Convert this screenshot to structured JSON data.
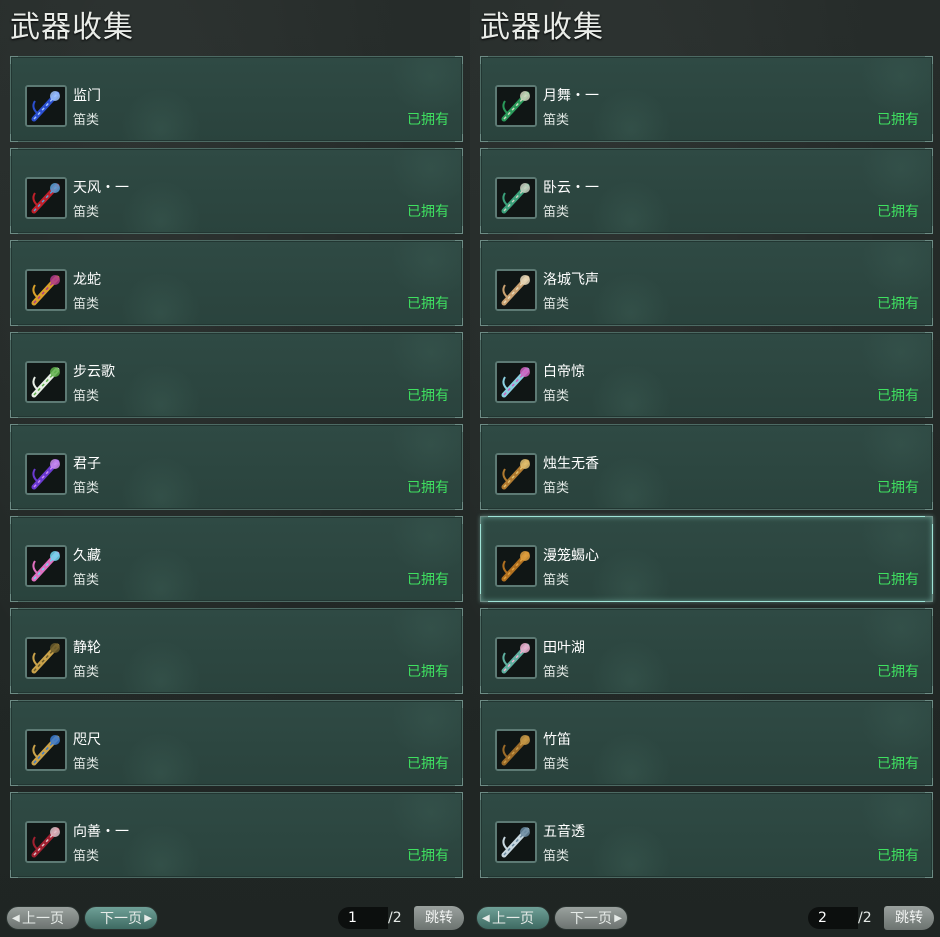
{
  "left": {
    "title": "武器收集",
    "items": [
      {
        "name": "监门",
        "type": "笛类",
        "status": "已拥有",
        "icon": "blue-flute-icon"
      },
      {
        "name": "天风・一",
        "type": "笛类",
        "status": "已拥有",
        "icon": "red-feather-flute-icon"
      },
      {
        "name": "龙蛇",
        "type": "笛类",
        "status": "已拥有",
        "icon": "golden-flute-icon"
      },
      {
        "name": "步云歌",
        "type": "笛类",
        "status": "已拥有",
        "icon": "white-leaf-flute-icon"
      },
      {
        "name": "君子",
        "type": "笛类",
        "status": "已拥有",
        "icon": "purple-flute-icon"
      },
      {
        "name": "久藏",
        "type": "笛类",
        "status": "已拥有",
        "icon": "crystal-flower-flute-icon"
      },
      {
        "name": "静轮",
        "type": "笛类",
        "status": "已拥有",
        "icon": "gold-fan-flute-icon"
      },
      {
        "name": "咫尺",
        "type": "笛类",
        "status": "已拥有",
        "icon": "gold-blue-flute-icon"
      },
      {
        "name": "向善・一",
        "type": "笛类",
        "status": "已拥有",
        "icon": "red-spiked-flute-icon"
      }
    ],
    "pager": {
      "prev": "上一页",
      "next": "下一页",
      "page": "1",
      "total": "/2",
      "jump": "跳转"
    }
  },
  "right": {
    "title": "武器收集",
    "items": [
      {
        "name": "月舞・一",
        "type": "笛类",
        "status": "已拥有",
        "icon": "green-dragon-flute-icon"
      },
      {
        "name": "卧云・一",
        "type": "笛类",
        "status": "已拥有",
        "icon": "jade-dragon-flute-icon"
      },
      {
        "name": "洛城飞声",
        "type": "笛类",
        "status": "已拥有",
        "icon": "tan-ribbon-flute-icon"
      },
      {
        "name": "白帝惊",
        "type": "笛类",
        "status": "已拥有",
        "icon": "ice-flower-flute-icon"
      },
      {
        "name": "烛生无香",
        "type": "笛类",
        "status": "已拥有",
        "icon": "bronze-flute-icon"
      },
      {
        "name": "漫笼蝎心",
        "type": "笛类",
        "status": "已拥有",
        "icon": "scorpion-flute-icon"
      },
      {
        "name": "田叶湖",
        "type": "笛类",
        "status": "已拥有",
        "icon": "lotus-flute-icon"
      },
      {
        "name": "竹笛",
        "type": "笛类",
        "status": "已拥有",
        "icon": "bamboo-flute-icon"
      },
      {
        "name": "五音透",
        "type": "笛类",
        "status": "已拥有",
        "icon": "silver-spike-flute-icon"
      }
    ],
    "selected_index": 5,
    "pager": {
      "prev": "上一页",
      "next": "下一页",
      "page": "2",
      "total": "/2",
      "jump": "跳转"
    }
  },
  "colors": {
    "owned": "#3fe060",
    "card": "#2f4a44",
    "selected_border": "#9fe3d6"
  }
}
